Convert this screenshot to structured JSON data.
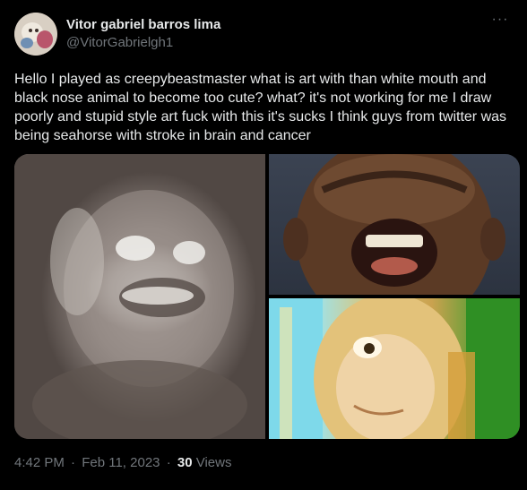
{
  "author": {
    "display_name": "Vitor gabriel barros lima",
    "handle": "@VitorGabrielgh1",
    "avatar_icon": "avatar-photo"
  },
  "more_icon": "more-horizontal-icon",
  "tweet": {
    "text": "Hello I played as creepybeastmaster what is art with than white mouth and black nose animal to become too cute? what? it's not working for me I draw poorly and stupid style art fuck with this it's sucks I think guys from twitter was being seahorse with stroke in brain and cancer"
  },
  "media": {
    "count": 3,
    "images": [
      "blurry-grinning-face-photo",
      "screaming-bald-man-photo",
      "cartoon-blonde-girl-closeup"
    ]
  },
  "meta": {
    "time": "4:42 PM",
    "separator": "·",
    "date": "Feb 11, 2023",
    "views_count": "30",
    "views_label": "Views"
  },
  "colors": {
    "background": "#000000",
    "text_primary": "#e7e9ea",
    "text_secondary": "#71767b"
  }
}
